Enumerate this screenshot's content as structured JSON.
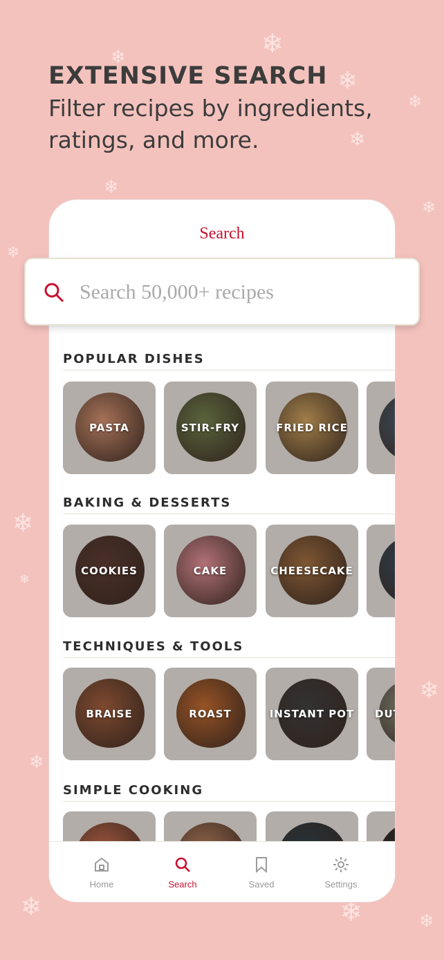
{
  "promo": {
    "headline": "EXTENSIVE SEARCH",
    "subheadline": "Filter recipes by ingredients, ratings, and more."
  },
  "screen": {
    "title": "Search"
  },
  "search": {
    "placeholder": "Search 50,000+ recipes",
    "value": ""
  },
  "sections": [
    {
      "title": "POPULAR DISHES",
      "items": [
        {
          "label": "PASTA",
          "color": "#c98a6b"
        },
        {
          "label": "STIR-FRY",
          "color": "#6d7a4a"
        },
        {
          "label": "FRIED RICE",
          "color": "#c39a5a"
        },
        {
          "label": "",
          "color": "#4a5a6a"
        }
      ]
    },
    {
      "title": "BAKING & DESSERTS",
      "items": [
        {
          "label": "COOKIES",
          "color": "#5a3a32"
        },
        {
          "label": "CAKE",
          "color": "#d98a92"
        },
        {
          "label": "CHEESECAKE",
          "color": "#9a6a3e"
        },
        {
          "label": "",
          "color": "#3a4a5a"
        }
      ]
    },
    {
      "title": "TECHNIQUES & TOOLS",
      "items": [
        {
          "label": "BRAISE",
          "color": "#9a5a3a"
        },
        {
          "label": "ROAST",
          "color": "#b8652e"
        },
        {
          "label": "INSTANT POT",
          "color": "#3e3e3e"
        },
        {
          "label": "DUT",
          "color": "#8a8a7a"
        }
      ]
    },
    {
      "title": "SIMPLE COOKING",
      "items": [
        {
          "label": "",
          "color": "#c0684a"
        },
        {
          "label": "",
          "color": "#b07a5a"
        },
        {
          "label": "",
          "color": "#2f3e46"
        },
        {
          "label": "",
          "color": "#2a2a2a"
        }
      ]
    }
  ],
  "tabbar": {
    "home": "Home",
    "search": "Search",
    "saved": "Saved",
    "settings": "Settings"
  },
  "colors": {
    "accent": "#c8102e",
    "background": "#f4c2bd"
  }
}
